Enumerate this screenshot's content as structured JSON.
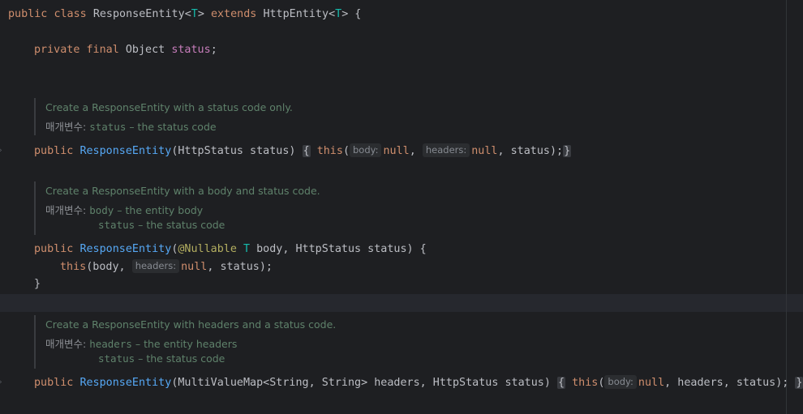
{
  "code": {
    "class_decl": {
      "kw1": "public",
      "kw2": "class",
      "name": "ResponseEntity",
      "lt": "<",
      "tparam": "T",
      "gt": ">",
      "kw3": "extends",
      "parent": "HttpEntity",
      "lt2": "<",
      "tparam2": "T",
      "gt2": ">",
      "brace": " {"
    },
    "field_decl": {
      "kw1": "private",
      "kw2": "final",
      "type": "Object",
      "name": "status",
      "semi": ";"
    },
    "doc1": {
      "summary": "Create a ResponseEntity with a status code only.",
      "label": "매개변수:",
      "params": [
        {
          "name": "status",
          "desc": " – the status code"
        }
      ]
    },
    "ctor1": {
      "kw": "public",
      "name": "ResponseEntity",
      "sig": "(HttpStatus status)",
      "open": "{",
      "this_kw": "this",
      "paren": "(",
      "hint1": "body:",
      "null1": "null",
      "comma1": ", ",
      "hint2": "headers:",
      "null2": "null",
      "rest": ", status);",
      "close": "}"
    },
    "doc2": {
      "summary": "Create a ResponseEntity with a body and status code.",
      "label": "매개변수:",
      "params": [
        {
          "name": "body",
          "desc": " – the entity body"
        },
        {
          "name": "status",
          "desc": " – the status code"
        }
      ]
    },
    "ctor2": {
      "kw": "public",
      "name": "ResponseEntity",
      "paren": "(",
      "annot": "@Nullable",
      "tparam": "T",
      "sig_rest": " body, HttpStatus status) {",
      "body_this": "this",
      "body_args1": "(body, ",
      "hint": "headers:",
      "null": "null",
      "body_args2": ", status);",
      "close": "}"
    },
    "doc3": {
      "summary": "Create a ResponseEntity with headers and a status code.",
      "label": "매개변수:",
      "params": [
        {
          "name": "headers",
          "desc": " – the entity headers"
        },
        {
          "name": "status",
          "desc": " – the status code"
        }
      ]
    },
    "ctor3": {
      "kw": "public",
      "name": "ResponseEntity",
      "sig": "(MultiValueMap<String, String> headers, HttpStatus status)",
      "open": "{",
      "this_kw": "this",
      "paren": "(",
      "hint1": "body:",
      "null1": "null",
      "rest": ", headers, status);",
      "close": "}"
    }
  },
  "colors": {
    "background": "#1e1f22",
    "keyword": "#cf8e6d",
    "method": "#56a8f5",
    "field": "#c77dbb",
    "doc": "#5f826b",
    "generic": "#16baac",
    "annotation": "#b3ae60"
  }
}
